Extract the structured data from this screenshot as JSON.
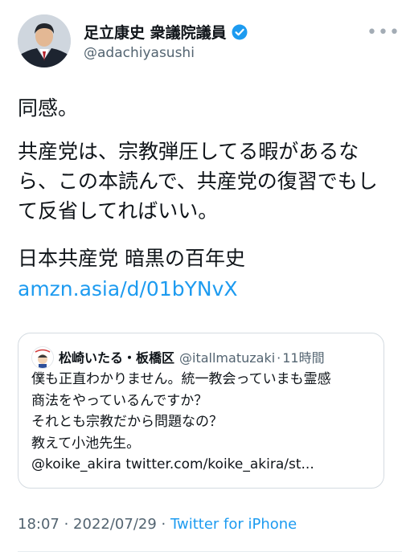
{
  "author": {
    "display_name": "足立康史 衆議院議員",
    "handle": "@adachiyasushi",
    "verified_icon": "verified-badge-icon",
    "more_icon": "more-horizontal-icon"
  },
  "tweet": {
    "lines": [
      "同感。",
      "共産党は、宗教弾圧してる暇があるなら、この本読んで、共産党の復習でもして反省してればいい。",
      "日本共産党 暗黒の百年史"
    ],
    "link": "amzn.asia/d/01bYNvX"
  },
  "quote": {
    "name": "松崎いたる・板橋区",
    "handle": "@itallmatuzaki",
    "separator": "·",
    "time": "11時間",
    "text_lines": [
      "僕も正直わかりません。統一教会っていまも霊感",
      "商法をやっているんですか？",
      "それとも宗教だから問題なの？",
      "教えて小池先生。",
      "@koike_akira twitter.com/koike_akira/st..."
    ]
  },
  "meta": {
    "time": "18:07",
    "separator": " · ",
    "date": "2022/07/29",
    "source": "Twitter for iPhone"
  },
  "colors": {
    "link": "#1d9bf0",
    "secondary_text": "#536471",
    "primary_text": "#0f1419"
  }
}
